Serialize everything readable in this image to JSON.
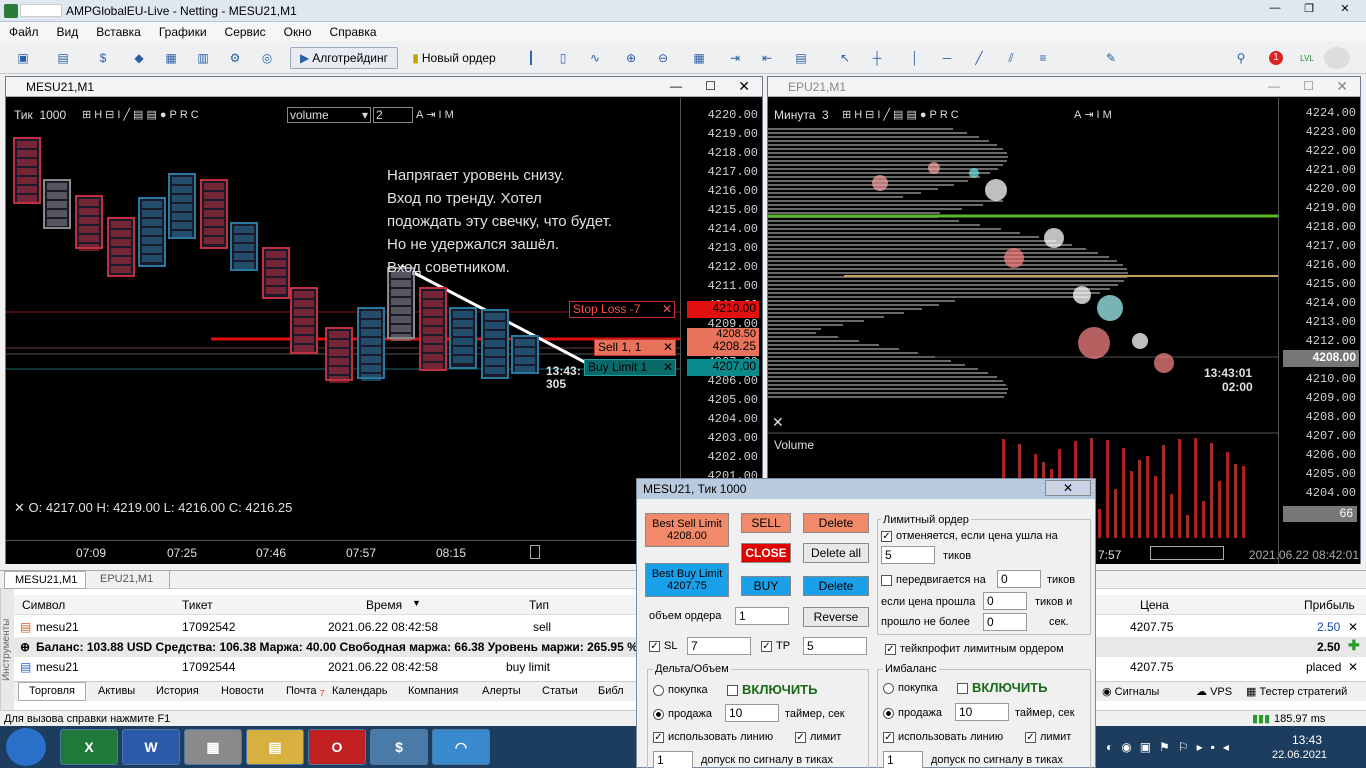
{
  "window_title": "AMPGlobalEU-Live - Netting - MESU21,M1",
  "menu": [
    "Файл",
    "Вид",
    "Вставка",
    "Графики",
    "Сервис",
    "Окно",
    "Справка"
  ],
  "toolbar": {
    "algo": "Алготрейдинг",
    "neworder": "Новый ордер"
  },
  "notif_count": "1",
  "lvl": "LVL",
  "chart1": {
    "title": "MESU21,M1",
    "tick_label": "Тик",
    "tick_val": "1000",
    "select_val": "volume",
    "spin_val": "2",
    "prices": [
      "4220.00",
      "4219.00",
      "4218.00",
      "4217.00",
      "4216.00",
      "4215.00",
      "4214.00",
      "4213.00",
      "4212.00",
      "4211.00",
      "4210.00",
      "4209.00",
      "4208.00",
      "4207.00",
      "4206.00",
      "4205.00",
      "4204.00",
      "4203.00",
      "4202.00",
      "4201.00"
    ],
    "price_top": "4221.00",
    "annotation": [
      "Напрягает уровень снизу.",
      "Вход по тренду. Хотел",
      "подождать эту свечку, что будет.",
      "Но не удержался зашёл.",
      "Вход советником."
    ],
    "stoploss": "Stop Loss  -7",
    "stoploss_price": "4210.00",
    "sell": "Sell  1,  1",
    "sell_price": "4208.25",
    "sell_price2": "4208.50",
    "buylimit": "Buy Limit  1",
    "buylimit_price": "4207.00",
    "time": "13:43:",
    "count": "305",
    "ohlc": "O: 4217.00   H: 4219.00   L: 4216.00   C: 4216.25",
    "times": [
      "07:09",
      "07:25",
      "07:46",
      "07:57",
      "08:15"
    ]
  },
  "chart2": {
    "title": "EPU21,M1",
    "label": "Минута",
    "label_val": "3",
    "prices": [
      "4224.00",
      "4223.00",
      "4222.00",
      "4221.00",
      "4220.00",
      "4219.00",
      "4218.00",
      "4217.00",
      "4216.00",
      "4215.00",
      "4214.00",
      "4213.00",
      "4212.00",
      "4211.00",
      "4210.00",
      "4209.00",
      "4208.00",
      "4207.00",
      "4206.00",
      "4205.00",
      "4204.00"
    ],
    "current": "4208.00",
    "time": "13:43:01",
    "time2": "02:00",
    "volume": "Volume",
    "vol_val": "66",
    "time_left": "7:57",
    "date": "2021.06.22 08:42:01"
  },
  "dialog": {
    "title": "MESU21, Тик  1000",
    "best_sell": "Best Sell Limit",
    "best_sell_price": "4208.00",
    "best_buy": "Best Buy Limit",
    "best_buy_price": "4207.75",
    "sell": "SELL",
    "close": "CLOSE",
    "buy": "BUY",
    "delete": "Delete",
    "delete_all": "Delete all",
    "delete2": "Delete",
    "reverse": "Reverse",
    "volume_label": "объем ордера",
    "volume_val": "1",
    "sl": "SL",
    "sl_val": "7",
    "tp": "TP",
    "tp_val": "5",
    "limit_group": "Лимитный ордер",
    "cancel_if": "отменяется, если цена ушла на",
    "cancel_val": "5",
    "ticks": "тиков",
    "moves": "передвигается на",
    "moves_val": "0",
    "ticks2": "тиков",
    "if_passed": "если цена прошла",
    "passed_val": "0",
    "ticks_and": "тиков и",
    "not_more": "прошло не более",
    "not_more_val": "0",
    "sec": "сек.",
    "tp_limit": "тейкпрофит лимитным ордером",
    "delta_group": "Дельта/Объем",
    "imb_group": "Имбаланс",
    "buy_opt": "покупка",
    "sell_opt": "продажа",
    "enable": "ВКЛЮЧИТЬ",
    "timer_val": "10",
    "timer_label": "таймер, сек",
    "use_line": "использовать линию",
    "limit": "лимит",
    "tol_val": "1",
    "tol_label": "допуск по сигналу в тиках"
  },
  "terminal": {
    "tabs_top": [
      "MESU21,M1",
      "EPU21,M1"
    ],
    "headers": [
      "Символ",
      "Тикет",
      "Время",
      "Тип",
      "Цена",
      "Прибыль"
    ],
    "rows": [
      {
        "sym": "mesu21",
        "ticket": "17092542",
        "time": "2021.06.22 08:42:58",
        "type": "sell",
        "price": "4207.75",
        "profit": "2.50"
      },
      {
        "sym": "mesu21",
        "ticket": "17092544",
        "time": "2021.06.22 08:42:58",
        "type": "buy limit",
        "price": "4207.75",
        "profit": "placed"
      }
    ],
    "balance": "Баланс: 103.88 USD  Средства: 106.38  Маржа: 40.00  Свободная маржа: 66.38  Уровень маржи: 265.95 %",
    "balance_profit": "2.50",
    "bottom_tabs": [
      "Торговля",
      "Активы",
      "История",
      "Новости",
      "Почта",
      "Календарь",
      "Компания",
      "Алерты",
      "Статьи",
      "Библ"
    ],
    "mail_count": "7",
    "right_tabs": [
      "Сигналы",
      "VPS",
      "Тестер стратегий"
    ],
    "side": "Инструменты"
  },
  "status": {
    "help": "Для вызова справки нажмите F1",
    "ping": "185.97 ms"
  },
  "taskbar": {
    "time": "13:43",
    "date": "22.06.2021"
  }
}
